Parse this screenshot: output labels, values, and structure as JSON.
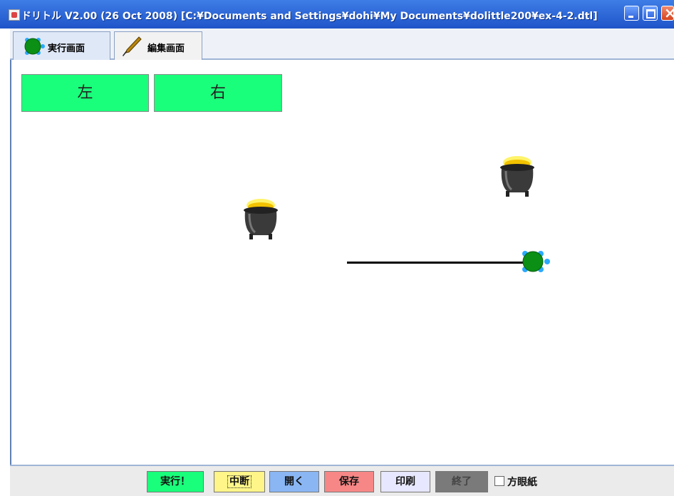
{
  "window": {
    "title": "ドリトル V2.00 (26 Oct 2008)  [C:¥Documents and Settings¥dohi¥My Documents¥dolittle200¥ex-4-2.dtl]"
  },
  "tabs": [
    {
      "label": "実行画面",
      "icon": "turtle-icon",
      "selected": true
    },
    {
      "label": "編集画面",
      "icon": "pen-icon",
      "selected": false
    }
  ],
  "canvas": {
    "buttons": [
      {
        "label": "左",
        "color": "#1aff7b"
      },
      {
        "label": "右",
        "color": "#1aff7b"
      }
    ],
    "objects": [
      "gold-pot-icon",
      "gold-pot-icon",
      "turtle-icon"
    ],
    "line_color": "#000000"
  },
  "toolbar": {
    "run": "実行！",
    "stop": "中断",
    "open": "開く",
    "save": "保存",
    "print": "印刷",
    "quit": "終了",
    "graph_paper": "方眼紙",
    "graph_paper_checked": false
  },
  "colors": {
    "titlebar": "#2a60d4",
    "run": "#1aff7b",
    "stop": "#fff588",
    "open": "#8ab6f3",
    "save": "#f78787",
    "print": "#e7e7ff",
    "quit": "#7a7a7a"
  }
}
